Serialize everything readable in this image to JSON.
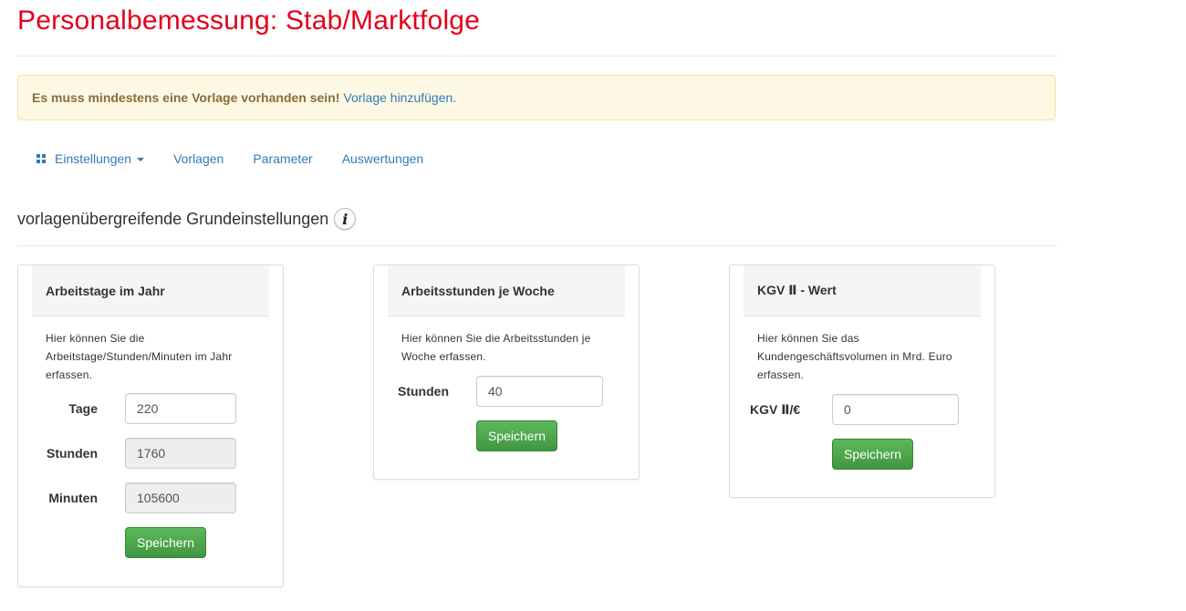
{
  "page": {
    "title": "Personalbemessung: Stab/Marktfolge"
  },
  "alert": {
    "message": "Es muss mindestens eine Vorlage vorhanden sein!",
    "link": "Vorlage hinzufügen."
  },
  "nav": {
    "items": [
      "Einstellungen",
      "Vorlagen",
      "Parameter",
      "Auswertungen"
    ]
  },
  "section": {
    "title": "vorlagenübergreifende Grundeinstellungen",
    "info_icon": "i"
  },
  "panels": {
    "arbeitstage": {
      "title": "Arbeitstage im Jahr",
      "description": "Hier können Sie die Arbeitstage/Stunden/Minuten im Jahr erfassen.",
      "fields": [
        {
          "label": "Tage",
          "value": "220"
        },
        {
          "label": "Stunden",
          "value": "1760"
        },
        {
          "label": "Minuten",
          "value": "105600"
        }
      ],
      "save_label": "Speichern"
    },
    "arbeitsstunden": {
      "title": "Arbeitsstunden je Woche",
      "description": "Hier können Sie die Arbeitsstunden je Woche erfassen.",
      "fields": [
        {
          "label": "Stunden",
          "value": "40"
        }
      ],
      "save_label": "Speichern"
    },
    "kgv": {
      "title": "KGV Ⅱ - Wert",
      "description": "Hier können Sie das Kundengeschäftsvolumen in Mrd. Euro erfassen.",
      "fields": [
        {
          "label": "KGV Ⅱ/€",
          "value": "0"
        }
      ],
      "save_label": "Speichern"
    }
  },
  "colors": {
    "title_red": "#e2001a",
    "link_blue": "#337ab7",
    "alert_bg": "#fcf8e3",
    "alert_text": "#8a6d3b",
    "button_green": "#5cb85c"
  }
}
